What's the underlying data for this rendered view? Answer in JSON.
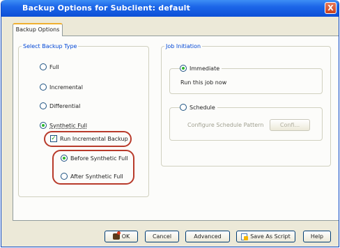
{
  "window": {
    "title": "Backup Options for Subclient: default",
    "close_glyph": "X"
  },
  "tabs": [
    {
      "label": "Backup Options"
    }
  ],
  "backup_type": {
    "legend": "Select Backup Type",
    "options": [
      {
        "label": "Full",
        "selected": false
      },
      {
        "label": "Incremental",
        "selected": false
      },
      {
        "label": "Differential",
        "selected": false
      },
      {
        "label": "Synthetic Full",
        "selected": true
      }
    ],
    "run_incremental": {
      "label": "Run Incremental Backup",
      "checked": true,
      "check_glyph": "✓"
    },
    "incremental_timing": [
      {
        "label": "Before Synthetic Full",
        "selected": true
      },
      {
        "label": "After Synthetic Full",
        "selected": false
      }
    ]
  },
  "job_initiation": {
    "legend": "Job Initiation",
    "immediate": {
      "label": "Immediate",
      "selected": true,
      "description": "Run this job now"
    },
    "schedule": {
      "label": "Schedule",
      "selected": false,
      "configure_label": "Configure Schedule Pattern",
      "configure_button": "Confi..."
    }
  },
  "footer_buttons": {
    "ok": "OK",
    "cancel": "Cancel",
    "advanced": "Advanced",
    "save_script": "Save As Script",
    "help": "Help"
  },
  "colors": {
    "highlight": "#b83a2a",
    "legend": "#0046d5",
    "titlebar": "#1c66e8"
  }
}
